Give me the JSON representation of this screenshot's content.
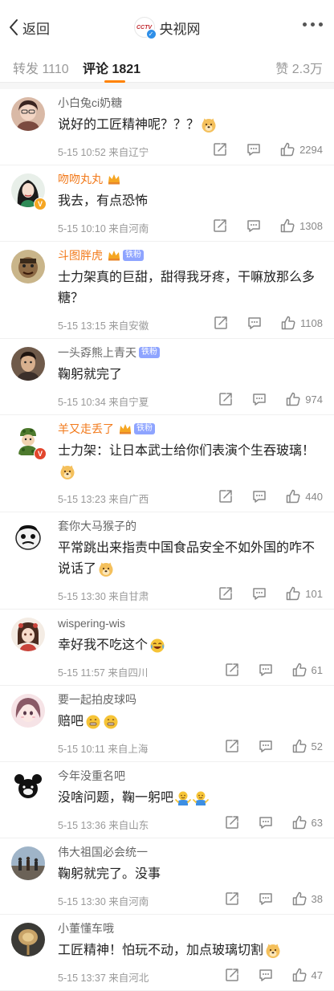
{
  "nav": {
    "back_label": "返回",
    "account_logo_text": "CCTV",
    "account_name": "央视网"
  },
  "tabs": {
    "repost": "转发 1110",
    "comment": "评论 1821",
    "like": "赞 2.3万"
  },
  "colors": {
    "accent": "#ff8200",
    "vip_name": "#f27a1b",
    "fan_badge": "#8ea4ff"
  },
  "comments": [
    {
      "user": "小白兔ci奶糖",
      "text": "说好的工匠精神呢？？？",
      "emoji": "doge",
      "date": "5-15 10:52 来自辽宁",
      "likes": "2294"
    },
    {
      "user": "吻吻丸丸",
      "text": "我去，有点恐怖",
      "date": "5-15 10:10 来自河南",
      "likes": "1308"
    },
    {
      "user": "斗图胖虎",
      "badge": "铁粉",
      "text": "士力架真的巨甜，甜得我牙疼，干嘛放那么多糖？",
      "date": "5-15 13:15 来自安徽",
      "likes": "1108"
    },
    {
      "user": "一头孬熊上青天",
      "badge": "铁粉",
      "text": "鞠躬就完了",
      "date": "5-15 10:34 来自宁夏",
      "likes": "974"
    },
    {
      "user": "羊又走丢了",
      "badge": "铁粉",
      "text": "士力架：让日本武士给你们表演个生吞玻璃！",
      "emoji": "doge",
      "date": "5-15 13:23 来自广西",
      "likes": "440"
    },
    {
      "user": "套你大马猴子的",
      "text": "平常跳出来指责中国食品安全不如外国的咋不说话了",
      "emoji": "doge",
      "date": "5-15 13:30 来自甘肃",
      "likes": "101"
    },
    {
      "user": "wispering-wis",
      "text": "幸好我不吃这个",
      "emoji": "laugh-cry",
      "date": "5-15 11:57 来自四川",
      "likes": "61"
    },
    {
      "user": "要一起拍皮球吗",
      "text": "赔吧",
      "emoji": "zip-mouth x2",
      "date": "5-15 10:11 来自上海",
      "likes": "52"
    },
    {
      "user": "今年没重名吧",
      "text": "没啥问题，鞠一躬吧",
      "emoji": "shrug x2",
      "date": "5-15 13:36 来自山东",
      "likes": "63"
    },
    {
      "user": "伟大祖国必会统一",
      "text": "鞠躬就完了。没事",
      "date": "5-15 13:30 来自河南",
      "likes": "38"
    },
    {
      "user": "小董懂车哦",
      "text": "工匠精神！怕玩不动，加点玻璃切割",
      "emoji": "doge",
      "date": "5-15 13:37 来自河北",
      "likes": "47"
    }
  ]
}
